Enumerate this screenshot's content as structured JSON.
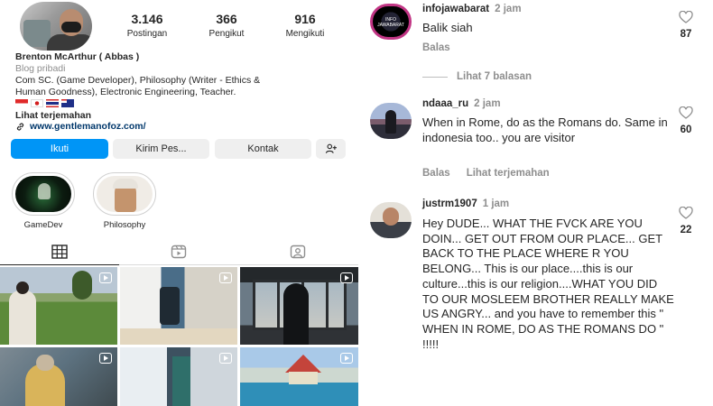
{
  "profile": {
    "stats": [
      {
        "value": "3.146",
        "label": "Postingan"
      },
      {
        "value": "366",
        "label": "Pengikut"
      },
      {
        "value": "916",
        "label": "Mengikuti"
      }
    ],
    "name": "Brenton McArthur ( Abbas )",
    "category": "Blog pribadi",
    "bio_line1": "Com SC. (Game Developer), Philosophy (Writer - Ethics &",
    "bio_line2": "Human Goodness), Electronic Engineering, Teacher.",
    "translate_label": "Lihat terjemahan",
    "website": "www.gentlemanofoz.com/",
    "buttons": {
      "follow": "Ikuti",
      "message": "Kirim Pes...",
      "contact": "Kontak"
    },
    "highlights": [
      {
        "label": "GameDev"
      },
      {
        "label": "Philosophy"
      }
    ]
  },
  "comments": [
    {
      "username": "infojawabarat",
      "time": "2 jam",
      "text": "Balik siah",
      "actions": [
        "Balas"
      ],
      "likes": "87",
      "avatar_text": "INFO JAWABARAT"
    },
    {
      "username": "ndaaa_ru",
      "time": "2 jam",
      "text": "When in Rome, do as the Romans do. Same in indonesia too.. you are visitor",
      "actions": [
        "Balas",
        "Lihat terjemahan"
      ],
      "likes": "60"
    },
    {
      "username": "justrm1907",
      "time": "1 jam",
      "text": "Hey DUDE... WHAT THE FVCK ARE YOU DOIN... GET OUT FROM OUR PLACE... GET BACK TO THE PLACE WHERE R YOU BELONG... This is our place....this is our culture...this is our religion....WHAT YOU DID TO OUR MOSLEEM  BROTHER REALLY MAKE US ANGRY... and you have to remember this \" WHEN IN ROME, DO AS THE ROMANS DO \" !!!!!",
      "likes": "22"
    }
  ],
  "replies_label": "Lihat 7 balasan",
  "colors": {
    "follow_button": "#0095f6",
    "link": "#00376b",
    "muted": "#8e8e8e",
    "text": "#262626"
  }
}
